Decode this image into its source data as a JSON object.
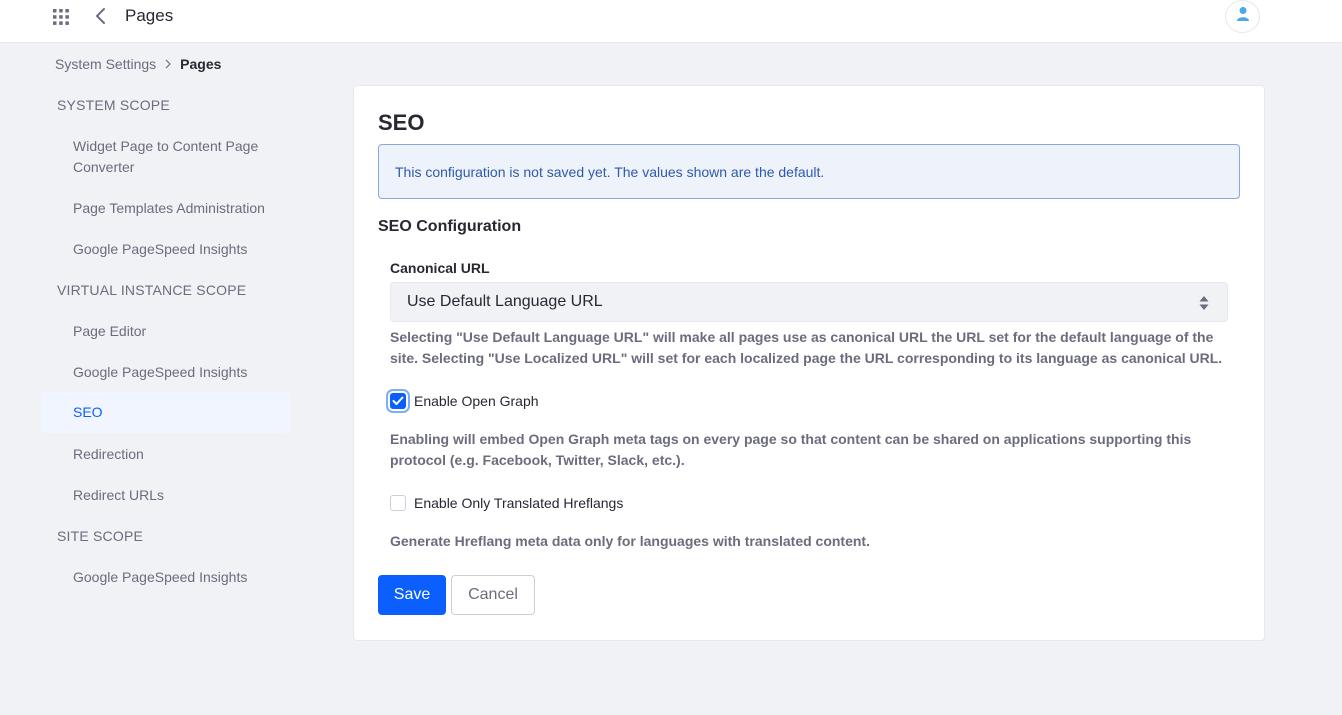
{
  "header": {
    "title": "Pages",
    "apps_icon": "grid-icon",
    "back_icon": "chevron-left-icon",
    "avatar_icon": "user-icon"
  },
  "breadcrumb": {
    "items": [
      "System Settings",
      "Pages"
    ]
  },
  "sidebar": {
    "system_scope": {
      "title": "SYSTEM SCOPE",
      "items": [
        "Widget Page to Content Page Converter",
        "Page Templates Administration",
        "Google PageSpeed Insights"
      ]
    },
    "virtual_instance_scope": {
      "title": "VIRTUAL INSTANCE SCOPE",
      "items": [
        "Page Editor",
        "Google PageSpeed Insights",
        "SEO",
        "Redirection",
        "Redirect URLs"
      ]
    },
    "site_scope": {
      "title": "SITE SCOPE",
      "items": [
        "Google PageSpeed Insights"
      ]
    },
    "active_item": "SEO"
  },
  "main": {
    "title": "SEO",
    "alert": "This configuration is not saved yet. The values shown are the default.",
    "section_title": "SEO Configuration",
    "canonical_url": {
      "label": "Canonical URL",
      "value": "Use Default Language URL",
      "help": "Selecting \"Use Default Language URL\" will make all pages use as canonical URL the URL set for the default language of the site. Selecting \"Use Localized URL\" will set for each localized page the URL corresponding to its language as canonical URL."
    },
    "open_graph": {
      "label": "Enable Open Graph",
      "checked": true,
      "help": "Enabling will embed Open Graph meta tags on every page so that content can be shared on applications supporting this protocol (e.g. Facebook, Twitter, Slack, etc.)."
    },
    "hreflangs": {
      "label": "Enable Only Translated Hreflangs",
      "checked": false,
      "help": "Generate Hreflang meta data only for languages with translated content."
    },
    "save_label": "Save",
    "cancel_label": "Cancel"
  },
  "colors": {
    "accent": "#0b5fff",
    "alert_bg": "#eef2fa",
    "alert_text": "#2e5aac",
    "page_bg": "#f1f2f5"
  }
}
